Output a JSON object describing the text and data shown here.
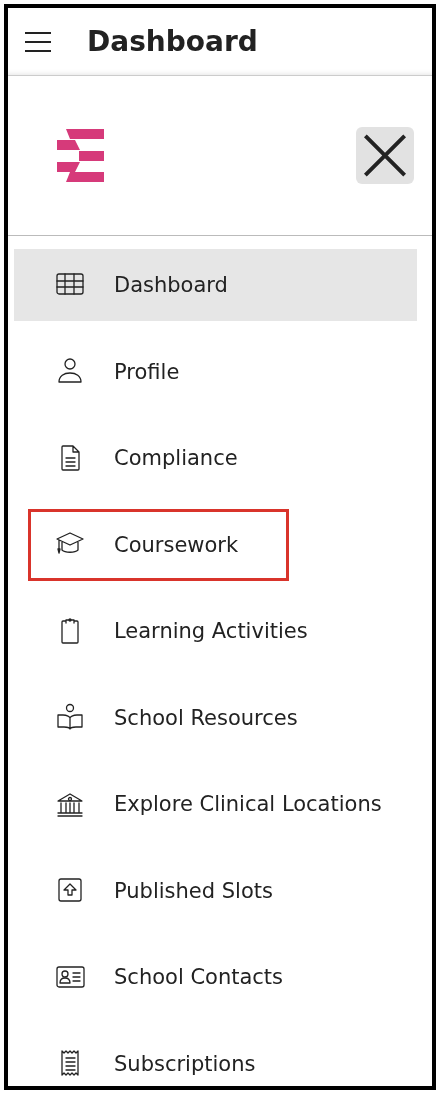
{
  "header": {
    "title": "Dashboard"
  },
  "nav": {
    "items": [
      {
        "label": "Dashboard",
        "selected": true,
        "highlighted": false
      },
      {
        "label": "Profile",
        "selected": false,
        "highlighted": false
      },
      {
        "label": "Compliance",
        "selected": false,
        "highlighted": false
      },
      {
        "label": "Coursework",
        "selected": false,
        "highlighted": true
      },
      {
        "label": "Learning Activities",
        "selected": false,
        "highlighted": false
      },
      {
        "label": "School Resources",
        "selected": false,
        "highlighted": false
      },
      {
        "label": "Explore Clinical Locations",
        "selected": false,
        "highlighted": false
      },
      {
        "label": "Published Slots",
        "selected": false,
        "highlighted": false
      },
      {
        "label": "School Contacts",
        "selected": false,
        "highlighted": false
      },
      {
        "label": "Subscriptions",
        "selected": false,
        "highlighted": false
      }
    ]
  }
}
